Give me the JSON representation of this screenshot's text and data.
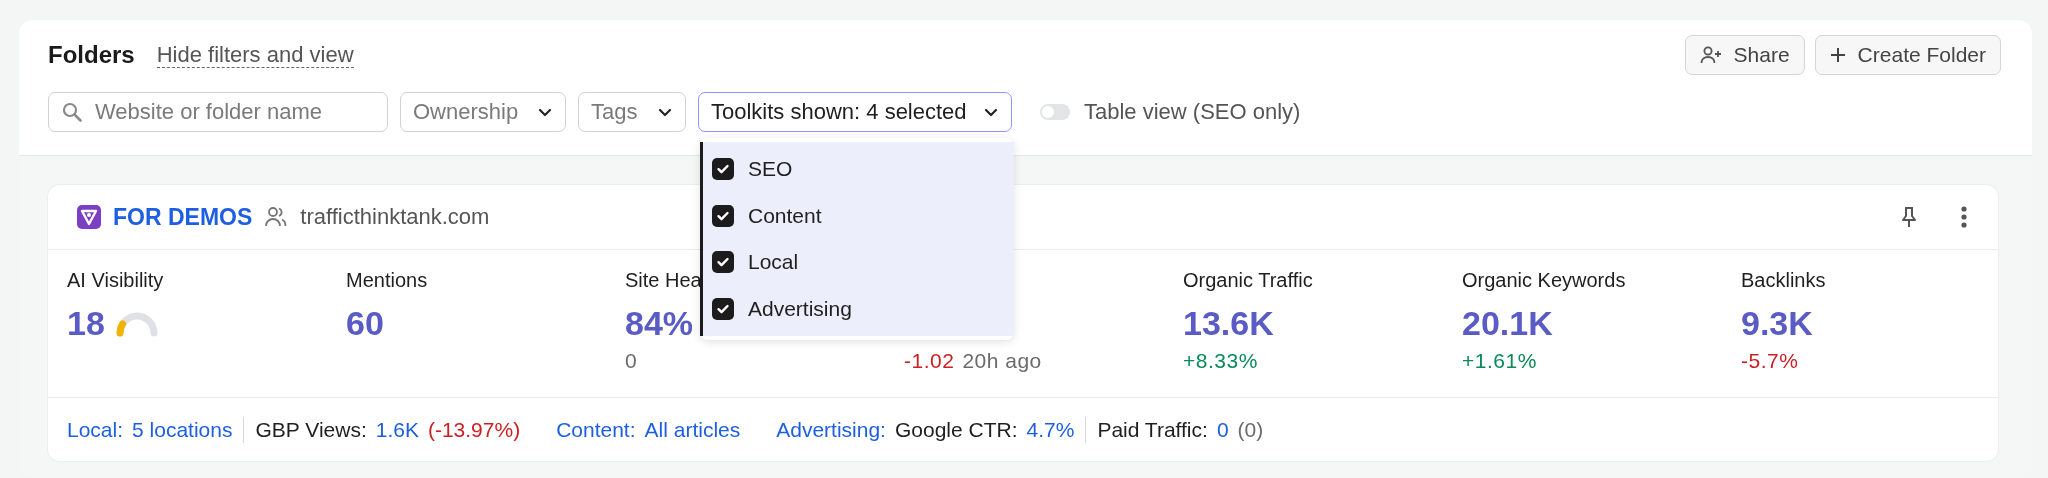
{
  "header": {
    "title": "Folders",
    "toggle_link": "Hide filters and view",
    "buttons": [
      {
        "label": "Share",
        "kind": "share"
      },
      {
        "label": "Create Folder",
        "kind": "create"
      }
    ]
  },
  "filters": {
    "search": {
      "placeholder": "Website or folder name"
    },
    "dropdowns": [
      {
        "label": "Ownership",
        "open": false
      },
      {
        "label": "Tags",
        "open": false
      },
      {
        "label": "Toolkits shown: 4 selected",
        "open": true,
        "options": [
          {
            "label": "SEO",
            "checked": true
          },
          {
            "label": "Content",
            "checked": true
          },
          {
            "label": "Local",
            "checked": true
          },
          {
            "label": "Advertising",
            "checked": true
          }
        ]
      }
    ],
    "table_view": {
      "label": "Table view (SEO only)",
      "on": false
    }
  },
  "project": {
    "name": "FOR DEMOS",
    "domain": "trafficthinktank.com",
    "metrics": [
      {
        "label": "AI Visibility",
        "value": "18",
        "kind": "gauge",
        "level": 0.18
      },
      {
        "label": "Mentions",
        "value": "60",
        "kind": "plain"
      },
      {
        "label": "Site Hea",
        "value": "84%",
        "kind": "plain",
        "change": "0",
        "color": "#6b6b6b"
      },
      {
        "kind": "plain",
        "change": "-1.02",
        "color": "#cc1f24",
        "note": "20h ago"
      },
      {
        "label": "Organic Traffic",
        "value": "13.6K",
        "kind": "plain",
        "change": "+8.33%",
        "color": "#0a8a5a"
      },
      {
        "label": "Organic Keywords",
        "value": "20.1K",
        "kind": "plain",
        "change": "+1.61%",
        "color": "#0a8a5a"
      },
      {
        "label": "Backlinks",
        "value": "9.3K",
        "kind": "plain",
        "change": "-5.7%",
        "color": "#cc1f24"
      }
    ],
    "footer": [
      {
        "divider_after": true,
        "parts": [
          {
            "text": "Local:",
            "kind": "link"
          },
          {
            "text": "5 locations",
            "kind": "link"
          }
        ]
      },
      {
        "divider_after": false,
        "parts": [
          {
            "text": "GBP Views:",
            "kind": "label"
          },
          {
            "text": "1.6K",
            "kind": "value"
          },
          {
            "text": "(-13.97%)",
            "kind": "drop"
          }
        ]
      },
      {
        "divider_after": false,
        "parts": [
          {
            "text": "Content:",
            "kind": "link"
          },
          {
            "text": "All articles",
            "kind": "link"
          }
        ]
      },
      {
        "divider_after": true,
        "parts": [
          {
            "text": "Advertising:",
            "kind": "link"
          },
          {
            "text": "Google CTR:",
            "kind": "label"
          },
          {
            "text": "4.7%",
            "kind": "value"
          }
        ]
      },
      {
        "divider_after": false,
        "parts": [
          {
            "text": "Paid Traffic:",
            "kind": "label"
          },
          {
            "text": "0",
            "kind": "value"
          },
          {
            "text": "(0)",
            "kind": "muted"
          }
        ]
      }
    ]
  }
}
